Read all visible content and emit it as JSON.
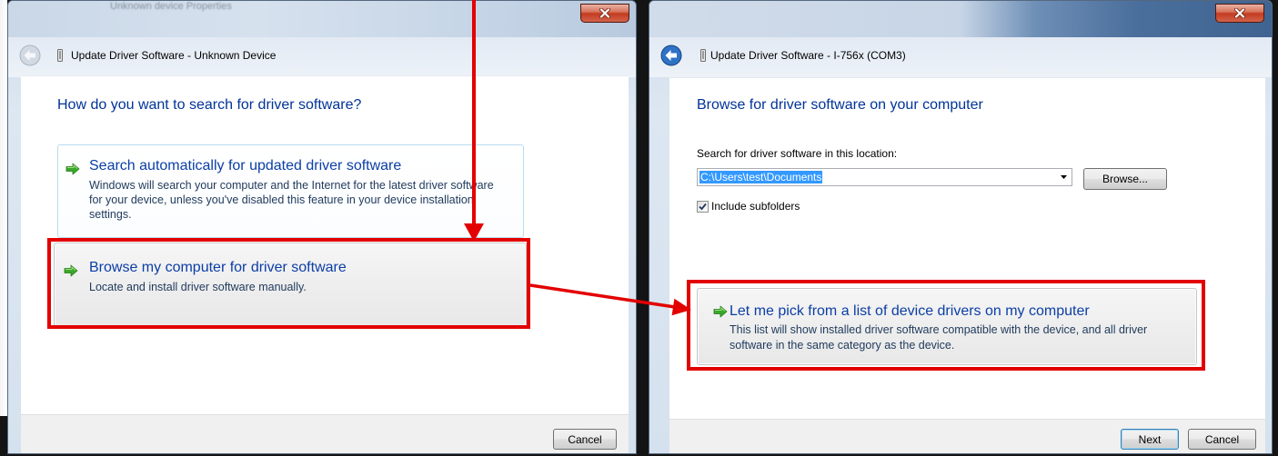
{
  "left_dialog": {
    "background_window_title": "Unknown device Properties",
    "title": "Update Driver Software - Unknown Device",
    "back_enabled": false,
    "heading": "How do you want to search for driver software?",
    "options": [
      {
        "title": "Search automatically for updated driver software",
        "description": "Windows will search your computer and the Internet for the latest driver software for your device, unless you've disabled this feature in your device installation settings.",
        "icon": "green-arrow-icon"
      },
      {
        "title": "Browse my computer for driver software",
        "description": "Locate and install driver software manually.",
        "icon": "green-arrow-icon"
      }
    ],
    "cancel_label": "Cancel"
  },
  "right_dialog": {
    "title": "Update Driver Software - I-756x (COM3)",
    "back_enabled": true,
    "heading": "Browse for driver software on your computer",
    "location_label": "Search for driver software in this location:",
    "location_value": "C:\\Users\\test\\Documents",
    "browse_label": "Browse...",
    "include_subfolders_label": "Include subfolders",
    "include_subfolders_checked": true,
    "option": {
      "title": "Let me pick from a list of device drivers on my computer",
      "description": "This list will show installed driver software compatible with the device, and all driver software in the same category as the device.",
      "icon": "green-arrow-icon"
    },
    "next_label": "Next",
    "cancel_label": "Cancel"
  },
  "icons": {
    "close": "close-icon",
    "back": "back-arrow-icon",
    "device": "device-icon",
    "command_link": "green-arrow-icon",
    "dropdown": "chevron-down-icon",
    "checkbox": "checkmark-icon"
  },
  "colors": {
    "annotation_red": "#e30000",
    "instruction_blue": "#003399",
    "link_title_blue": "#0b3ea6",
    "link_desc_blue": "#1e395b",
    "selection_blue": "#3399ff"
  }
}
